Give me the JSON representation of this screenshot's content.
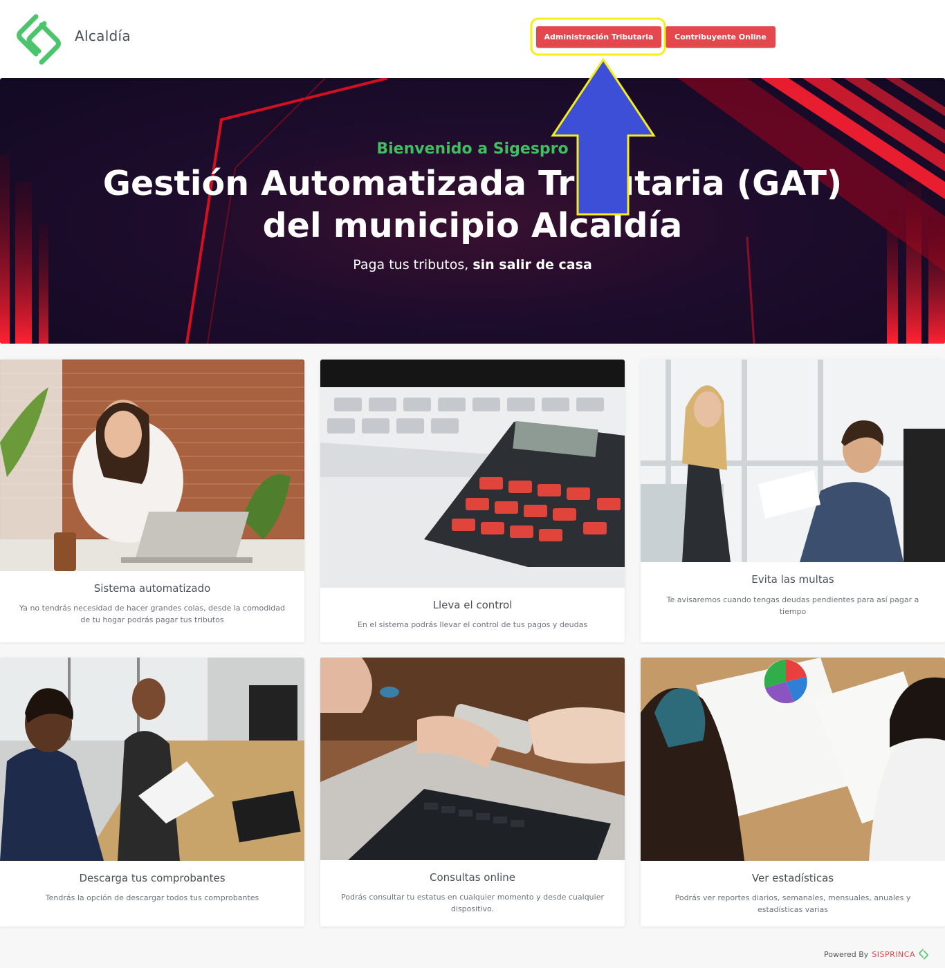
{
  "header": {
    "brand": "Alcaldía",
    "buttons": {
      "admin": "Administración Tributaria",
      "contrib": "Contribuyente Online"
    }
  },
  "hero": {
    "subtitle": "Bienvenido a Sigespro",
    "title": "Gestión Automatizada Tributaria (GAT) del municipio Alcaldía",
    "tagline_regular": "Paga tus tributos,",
    "tagline_bold": "sin salir de casa"
  },
  "cards": [
    {
      "title": "Sistema automatizado",
      "description": "Ya no tendrás necesidad de hacer grandes colas, desde la comodidad de tu hogar podrás pagar tus tributos",
      "image": "woman-headset-laptop-image"
    },
    {
      "title": "Lleva el control",
      "description": "En el sistema podrás llevar el control de tus pagos y deudas",
      "image": "calculator-keyboard-image"
    },
    {
      "title": "Evita las multas",
      "description": "Te avisaremos cuando tengas deudas pendientes para así pagar a tiempo",
      "image": "business-meeting-image"
    },
    {
      "title": "Descarga tus comprobantes",
      "description": "Tendrás la opción de descargar todos tus comprobantes",
      "image": "call-center-image"
    },
    {
      "title": "Consultas online",
      "description": "Podrás consultar tu estatus en cualquier momento y desde cualquier dispositivo.",
      "image": "phone-laptop-image"
    },
    {
      "title": "Ver estadísticas",
      "description": "Podrás ver reportes diarios, semanales, mensuales, anuales y estadísticas varias",
      "image": "charts-papers-image"
    }
  ],
  "footer": {
    "powered": "Powered By",
    "company": "SISPRINCA"
  },
  "colors": {
    "accent_red": "#e5474f",
    "brand_green": "#3fbf5f",
    "annotation_yellow": "#f5ee1a",
    "annotation_blue": "#3c4fd6"
  }
}
